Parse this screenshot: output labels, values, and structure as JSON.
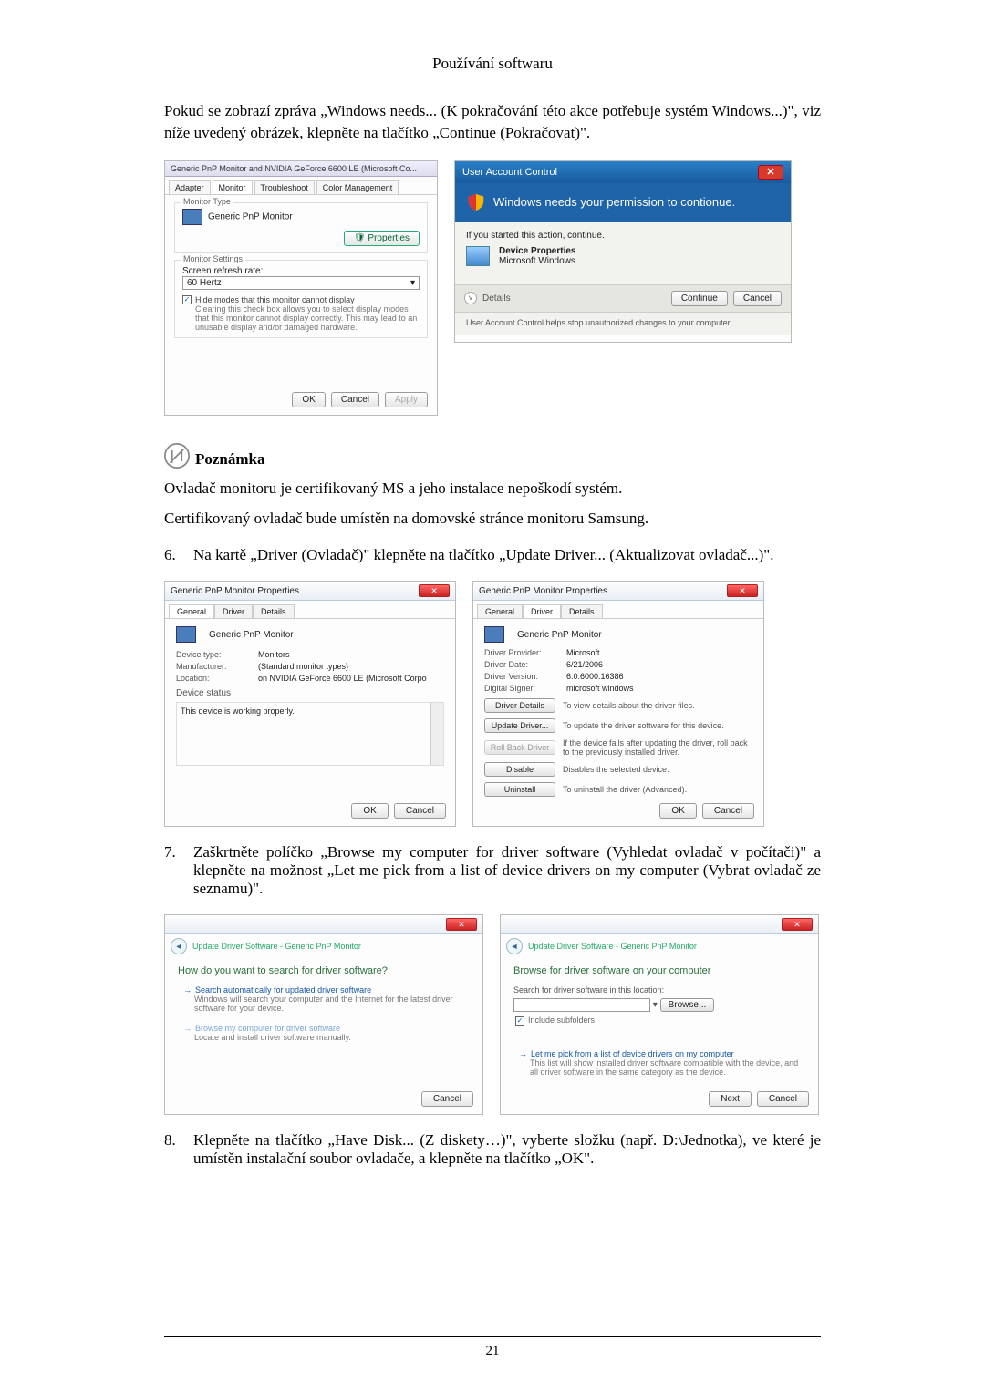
{
  "header": "Používání softwaru",
  "intro": "Pokud se zobrazí zpráva „Windows needs... (K pokračování této akce potřebuje systém Windows...)\", viz níže uvedený obrázek, klepněte na tlačítko „Continue (Pokračovat)\".",
  "shot1": {
    "title": "Generic PnP Monitor and NVIDIA GeForce 6600 LE (Microsoft Co...",
    "tabs": {
      "adapter": "Adapter",
      "monitor": "Monitor",
      "troubleshoot": "Troubleshoot",
      "color": "Color Management"
    },
    "group1_label": "Monitor Type",
    "monitor_name": "Generic PnP Monitor",
    "properties_btn": "Properties",
    "group2_label": "Monitor Settings",
    "refresh_label": "Screen refresh rate:",
    "refresh_value": "60 Hertz",
    "hide_label": "Hide modes that this monitor cannot display",
    "hide_desc": "Clearing this check box allows you to select display modes that this monitor cannot display correctly. This may lead to an unusable display and/or damaged hardware.",
    "ok": "OK",
    "cancel": "Cancel",
    "apply": "Apply"
  },
  "shot2": {
    "title": "User Account Control",
    "headline": "Windows needs your permission to contionue.",
    "sub": "If you started this action, continue.",
    "app1": "Device Properties",
    "app2": "Microsoft Windows",
    "details": "Details",
    "continue": "Continue",
    "cancel": "Cancel",
    "footer": "User Account Control helps stop unauthorized changes to your computer."
  },
  "note_label": "Poznámka",
  "note1": "Ovladač monitoru je certifikovaný MS a jeho instalace nepoškodí systém.",
  "note2": "Certifikovaný ovladač bude umístěn na domovské stránce monitoru Samsung.",
  "step6_num": "6.",
  "step6": "Na kartě „Driver (Ovladač)\" klepněte na tlačítko „Update Driver... (Aktualizovat ovladač...)\".",
  "shot3": {
    "title": "Generic PnP Monitor Properties",
    "tabs": {
      "general": "General",
      "driver": "Driver",
      "details": "Details"
    },
    "name": "Generic PnP Monitor",
    "k_type": "Device type:",
    "v_type": "Monitors",
    "k_mfr": "Manufacturer:",
    "v_mfr": "(Standard monitor types)",
    "k_loc": "Location:",
    "v_loc": "on NVIDIA GeForce 6600 LE (Microsoft Corpo",
    "status_label": "Device status",
    "status": "This device is working properly.",
    "ok": "OK",
    "cancel": "Cancel"
  },
  "shot4": {
    "title": "Generic PnP Monitor Properties",
    "name": "Generic PnP Monitor",
    "k_prov": "Driver Provider:",
    "v_prov": "Microsoft",
    "k_date": "Driver Date:",
    "v_date": "6/21/2006",
    "k_ver": "Driver Version:",
    "v_ver": "6.0.6000.16386",
    "k_sign": "Digital Signer:",
    "v_sign": "microsoft windows",
    "b_details": "Driver Details",
    "d_details": "To view details about the driver files.",
    "b_update": "Update Driver...",
    "d_update": "To update the driver software for this device.",
    "b_roll": "Roll Back Driver",
    "d_roll": "If the device fails after updating the driver, roll back to the previously installed driver.",
    "b_disable": "Disable",
    "d_disable": "Disables the selected device.",
    "b_uninstall": "Uninstall",
    "d_uninstall": "To uninstall the driver (Advanced).",
    "ok": "OK",
    "cancel": "Cancel"
  },
  "step7_num": "7.",
  "step7": "Zaškrtněte políčko „Browse my computer for driver software (Vyhledat ovladač v počítači)\" a klepněte na možnost „Let me pick from a list of device drivers on my computer (Vybrat ovladač ze seznamu)\".",
  "shot5": {
    "breadcrumb": "Update Driver Software - Generic PnP Monitor",
    "heading": "How do you want to search for driver software?",
    "opt1_h": "Search automatically for updated driver software",
    "opt1_d": "Windows will search your computer and the Internet for the latest driver software for your device.",
    "opt2_h": "Browse my computer for driver software",
    "opt2_d": "Locate and install driver software manually.",
    "cancel": "Cancel"
  },
  "shot6": {
    "breadcrumb": "Update Driver Software - Generic PnP Monitor",
    "heading": "Browse for driver software on your computer",
    "path_label": "Search for driver software in this location:",
    "browse": "Browse...",
    "include": "Include subfolders",
    "opt_h": "Let me pick from a list of device drivers on my computer",
    "opt_d": "This list will show installed driver software compatible with the device, and all driver software in the same category as the device.",
    "next": "Next",
    "cancel": "Cancel"
  },
  "step8_num": "8.",
  "step8": "Klepněte na tlačítko „Have Disk... (Z diskety…)\", vyberte složku (např. D:\\Jednotka), ve které je umístěn instalační soubor ovladače, a klepněte na tlačítko „OK\".",
  "page_number": "21"
}
